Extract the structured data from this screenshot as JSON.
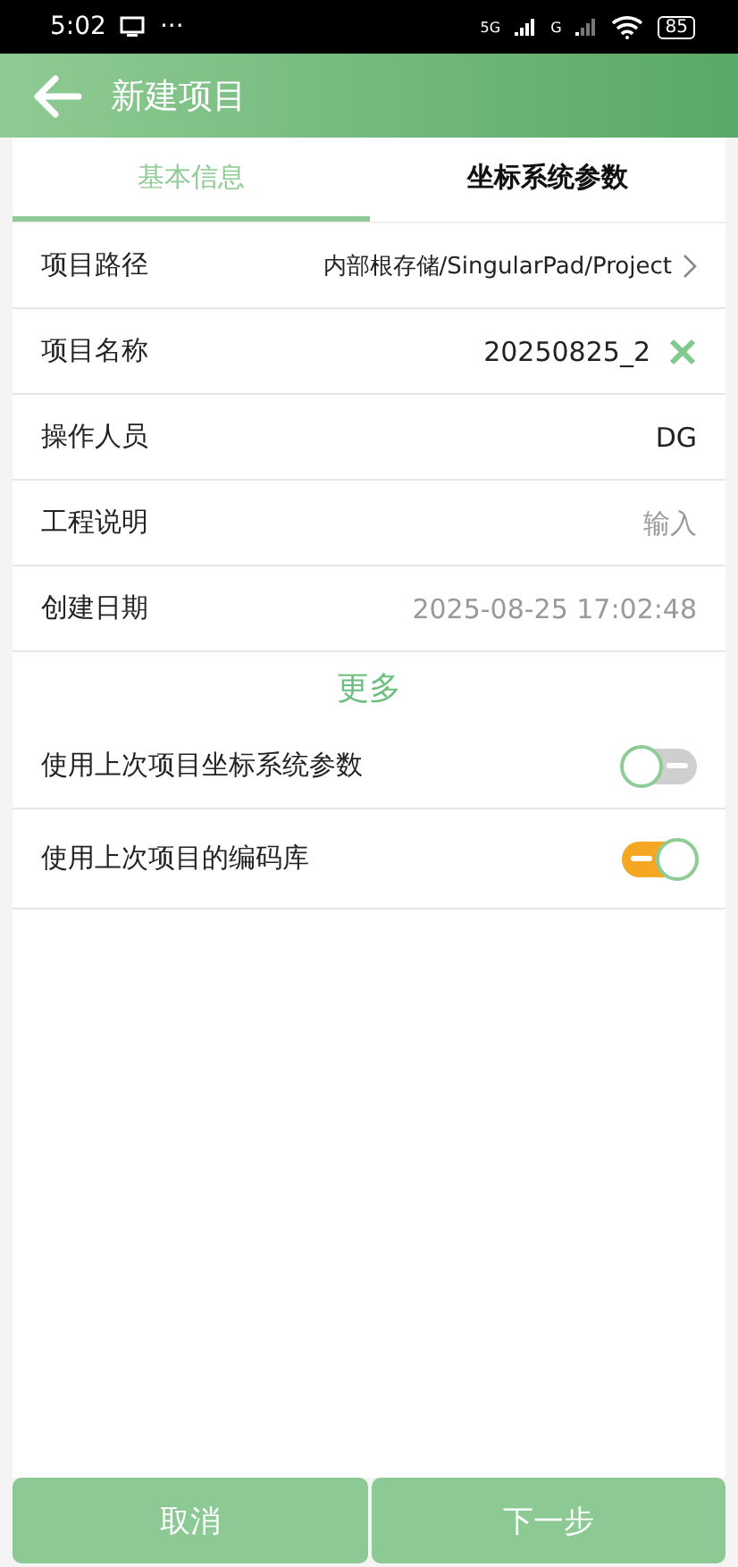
{
  "status_bar": {
    "time": "5:02",
    "more": "···",
    "network_1": "5G",
    "network_2": "G",
    "battery": "85"
  },
  "header": {
    "title": "新建项目"
  },
  "tabs": [
    {
      "label": "基本信息",
      "selected": true
    },
    {
      "label": "坐标系统参数",
      "selected": false
    }
  ],
  "fields": [
    {
      "kind": "link",
      "label": "项目路径",
      "value": "内部根存储/SingularPad/Project"
    },
    {
      "kind": "input",
      "label": "项目名称",
      "value": "20250825_2"
    },
    {
      "kind": "value",
      "label": "操作人员",
      "value": "DG"
    },
    {
      "kind": "input",
      "label": "工程说明",
      "placeholder": "输入"
    },
    {
      "kind": "readonly",
      "label": "创建日期",
      "value": "2025-08-25 17:02:48"
    }
  ],
  "more_label": "更多",
  "options": [
    {
      "label": "使用上次项目坐标系统参数",
      "on": false
    },
    {
      "label": "使用上次项目的编码库",
      "on": true
    }
  ],
  "buttons": [
    {
      "label": "取消"
    },
    {
      "label": "下一步"
    }
  ]
}
